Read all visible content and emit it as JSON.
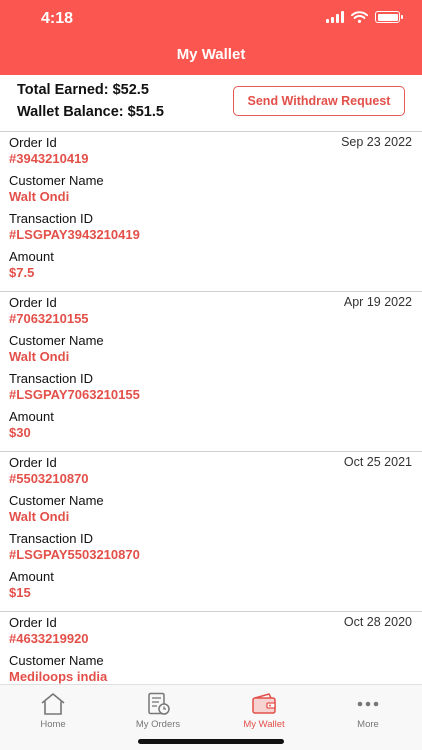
{
  "status_bar": {
    "time": "4:18"
  },
  "nav": {
    "title": "My Wallet"
  },
  "summary": {
    "total_earned": "Total Earned: $52.5",
    "wallet_balance": "Wallet Balance: $51.5",
    "withdraw_label": "Send Withdraw Request"
  },
  "labels": {
    "order_id": "Order Id",
    "customer_name": "Customer Name",
    "transaction_id": "Transaction ID",
    "amount": "Amount"
  },
  "orders": [
    {
      "date": "Sep 23 2022",
      "order_id": "#3943210419",
      "customer": "Walt Ondi",
      "transaction": "#LSGPAY3943210419",
      "amount": "$7.5"
    },
    {
      "date": "Apr 19 2022",
      "order_id": "#7063210155",
      "customer": "Walt Ondi",
      "transaction": "#LSGPAY7063210155",
      "amount": "$30"
    },
    {
      "date": "Oct 25 2021",
      "order_id": "#5503210870",
      "customer": "Walt Ondi",
      "transaction": "#LSGPAY5503210870",
      "amount": "$15"
    },
    {
      "date": "Oct 28 2020",
      "order_id": "#4633219920",
      "customer": "Mediloops india",
      "transaction": "",
      "amount": ""
    }
  ],
  "tabs": [
    {
      "label": "Home",
      "icon": "home-icon"
    },
    {
      "label": "My Orders",
      "icon": "orders-icon"
    },
    {
      "label": "My Wallet",
      "icon": "wallet-icon"
    },
    {
      "label": "More",
      "icon": "more-icon"
    }
  ],
  "colors": {
    "accent": "#fc5650",
    "value_red": "#e3504a",
    "tab_inactive": "#777777"
  },
  "active_tab": "My Wallet"
}
